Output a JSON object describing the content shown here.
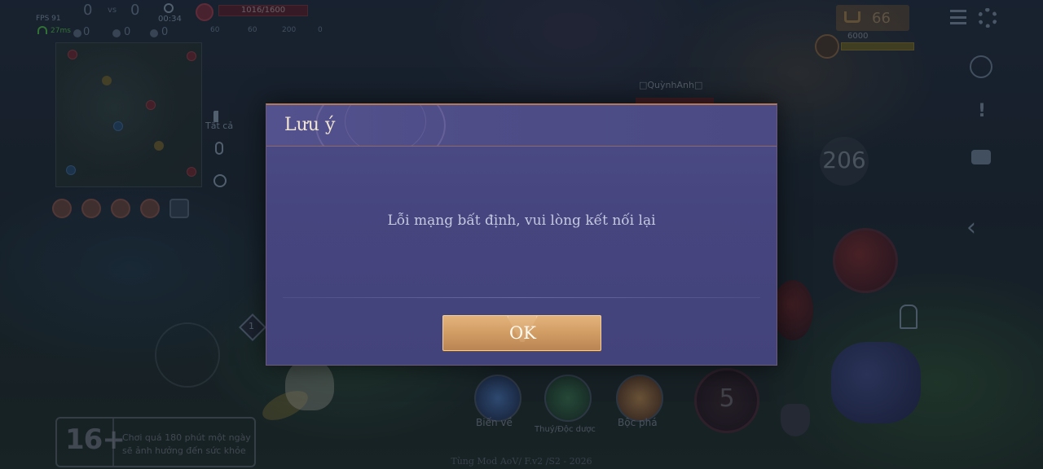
{
  "hud": {
    "fps": "FPS 91",
    "ping": "27ms",
    "score_left": "0",
    "vs": "vs",
    "score_right": "0",
    "timer": "00:34",
    "kills": "0",
    "deaths": "0",
    "assists": "0",
    "hp_text": "1016/1600",
    "stat_1": "60",
    "stat_2": "60",
    "stat_3": "200",
    "stat_4": "0"
  },
  "side_tools": {
    "mute_label": "Tắt cả"
  },
  "top_right": {
    "gold": "66",
    "turret_hp": "6000"
  },
  "cooldown": "206",
  "enemy_name": "□QuỳnhAnh□",
  "lane_marker": "1",
  "spells": {
    "flash_label": "Biến về",
    "heal_label": "Thuý/Độc dược",
    "punish_label": "Bộc phá"
  },
  "ultimate_level": "5",
  "age_rating": {
    "badge": "16+",
    "warning_line1": "Chơi quá 180 phút một ngày",
    "warning_line2": "sẽ ảnh hưởng đến sức khỏe"
  },
  "footer_credit": "Tùng Mod AoV/ F.v2 /S2 - 2026",
  "modal": {
    "title": "Lưu ý",
    "message": "Lỗi mạng bất định, vui lòng kết nối lại",
    "ok_label": "OK"
  },
  "colors": {
    "modal_bg": "#46457f",
    "modal_title": "#f1e6d2",
    "button_gold": "#cf9a62",
    "accent_border": "#b27a5a"
  }
}
